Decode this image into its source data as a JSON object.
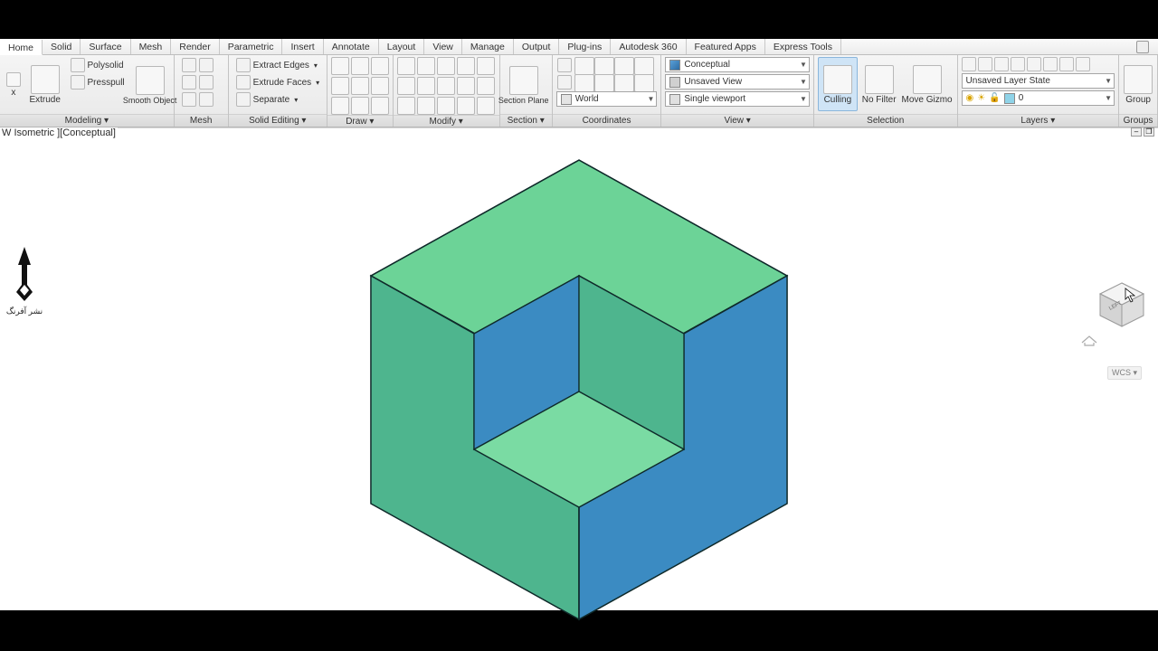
{
  "tabs": [
    "Home",
    "Solid",
    "Surface",
    "Mesh",
    "Render",
    "Parametric",
    "Insert",
    "Annotate",
    "Layout",
    "View",
    "Manage",
    "Output",
    "Plug-ins",
    "Autodesk 360",
    "Featured Apps",
    "Express Tools"
  ],
  "active_tab": 0,
  "panels": {
    "modeling": {
      "title": "Modeling ▾",
      "big": [
        "x",
        "Extrude",
        "Smooth Object"
      ],
      "rows": [
        "Polysolid",
        "Presspull"
      ]
    },
    "mesh": {
      "title": "Mesh"
    },
    "solid_editing": {
      "title": "Solid Editing ▾",
      "rows": [
        "Extract Edges",
        "Extrude Faces",
        "Separate"
      ]
    },
    "draw": {
      "title": "Draw ▾"
    },
    "modify": {
      "title": "Modify ▾"
    },
    "section": {
      "title": "Section ▾",
      "big": "Section Plane"
    },
    "coords": {
      "title": "Coordinates",
      "dd": "World"
    },
    "view": {
      "title": "View ▾",
      "dd1": "Conceptual",
      "dd2": "Unsaved View",
      "dd3": "Single viewport"
    },
    "selection": {
      "title": "Selection",
      "b1": "Culling",
      "b2": "No Filter",
      "b3": "Move Gizmo"
    },
    "layers": {
      "title": "Layers ▾",
      "state": "Unsaved Layer State",
      "current": "0"
    },
    "groups": {
      "title": "Groups",
      "big": "Group"
    }
  },
  "viewport_label": "W Isometric ][Conceptual]",
  "wcs": "WCS",
  "colors": {
    "top": "#6cd397",
    "top_shade": "#5fbd85",
    "left": "#4eb58e",
    "left_shade": "#45a07e",
    "right": "#3b8bc2",
    "right_shade": "#3277a6",
    "edge": "#0f2a2a"
  }
}
